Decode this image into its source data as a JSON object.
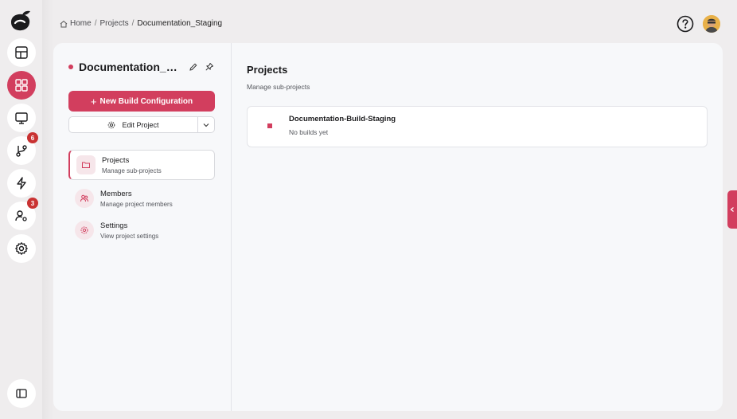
{
  "breadcrumb": {
    "home": "Home",
    "projects": "Projects",
    "current": "Documentation_Staging",
    "separator": "/"
  },
  "rail": {
    "badges": {
      "vcs": "6",
      "users": "3"
    }
  },
  "project": {
    "title": "Documentation_St...",
    "new_build_label": "New Build Configuration",
    "edit_label": "Edit Project"
  },
  "nav": [
    {
      "title": "Projects",
      "sub": "Manage sub-projects"
    },
    {
      "title": "Members",
      "sub": "Manage project members"
    },
    {
      "title": "Settings",
      "sub": "View project settings"
    }
  ],
  "content": {
    "title": "Projects",
    "subtitle": "Manage sub-projects",
    "subprojects": [
      {
        "name": "Documentation-Build-Staging",
        "status": "No builds yet"
      }
    ]
  },
  "colors": {
    "accent": "#d23e5e",
    "badge": "#c93232"
  }
}
